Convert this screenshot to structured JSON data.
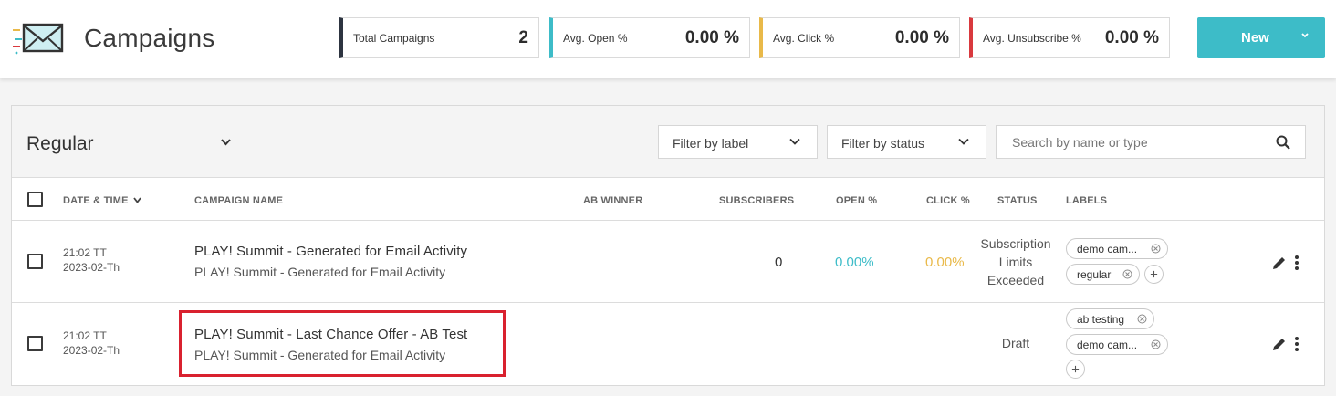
{
  "header": {
    "title": "Campaigns",
    "logo_icon": "envelope-icon"
  },
  "stats": [
    {
      "label": "Total Campaigns",
      "value": "2",
      "color": "#2d3440"
    },
    {
      "label": "Avg. Open %",
      "value": "0.00 %",
      "color": "#3dbcc8"
    },
    {
      "label": "Avg. Click %",
      "value": "0.00 %",
      "color": "#e9b949"
    },
    {
      "label": "Avg. Unsubscribe %",
      "value": "0.00 %",
      "color": "#d9393e"
    }
  ],
  "new_button": {
    "label": "New",
    "color": "#3dbcc8"
  },
  "toolbar": {
    "type_selected": "Regular",
    "filter_label": "Filter by label",
    "filter_status": "Filter by status",
    "search_placeholder": "Search by name or type"
  },
  "table": {
    "columns": {
      "date": "DATE & TIME",
      "name": "CAMPAIGN NAME",
      "ab_winner": "AB WINNER",
      "subscribers": "SUBSCRIBERS",
      "open": "OPEN %",
      "click": "CLICK %",
      "status": "STATUS",
      "labels": "LABELS"
    },
    "rows": [
      {
        "time": "21:02 TT",
        "date": "2023-02-Th",
        "name": "PLAY! Summit - Generated for Email Activity",
        "subtitle": "PLAY! Summit - Generated for Email Activity",
        "subscribers": "0",
        "open": "0.00%",
        "click": "0.00%",
        "status_lines": [
          "Subscription",
          "Limits",
          "Exceeded"
        ],
        "labels": [
          "demo cam...",
          "regular"
        ]
      },
      {
        "time": "21:02 TT",
        "date": "2023-02-Th",
        "name": "PLAY! Summit - Last Chance Offer - AB Test",
        "subtitle": "PLAY! Summit - Generated for Email Activity",
        "status": "Draft",
        "labels": [
          "ab testing",
          "demo cam..."
        ]
      }
    ]
  },
  "colors": {
    "open": "#3dbcc8",
    "click": "#e9b949",
    "highlight": "#d9212f"
  }
}
